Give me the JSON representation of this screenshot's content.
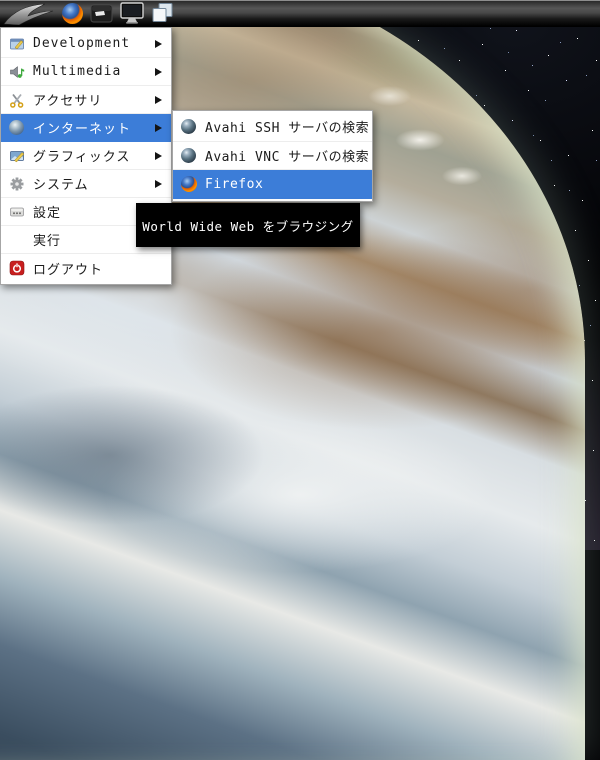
{
  "panel": {
    "launchers": [
      {
        "name": "lxde-menu"
      },
      {
        "name": "firefox"
      },
      {
        "name": "file-manager"
      },
      {
        "name": "display"
      },
      {
        "name": "windows"
      }
    ]
  },
  "menu": {
    "items": [
      {
        "label": "Development",
        "has_submenu": true,
        "highlighted": false
      },
      {
        "label": "Multimedia",
        "has_submenu": true,
        "highlighted": false
      },
      {
        "label": "アクセサリ",
        "has_submenu": true,
        "highlighted": false
      },
      {
        "label": "インターネット",
        "has_submenu": true,
        "highlighted": true
      },
      {
        "label": "グラフィックス",
        "has_submenu": true,
        "highlighted": false
      },
      {
        "label": "システム",
        "has_submenu": true,
        "highlighted": false
      },
      {
        "label": "設定",
        "has_submenu": false,
        "highlighted": false
      },
      {
        "label": "実行",
        "has_submenu": false,
        "highlighted": false
      },
      {
        "label": "ログアウト",
        "has_submenu": false,
        "highlighted": false
      }
    ]
  },
  "submenu": {
    "items": [
      {
        "label": "Avahi SSH サーバの検索",
        "highlighted": false
      },
      {
        "label": "Avahi VNC サーバの検索",
        "highlighted": false
      },
      {
        "label": "Firefox",
        "highlighted": true
      }
    ]
  },
  "tooltip": {
    "text": "World Wide Web をブラウジング"
  },
  "colors": {
    "highlight": "#3c7dd8",
    "menu_bg": "#ffffff",
    "tooltip_bg": "#000000",
    "tooltip_text": "#ffffff"
  }
}
